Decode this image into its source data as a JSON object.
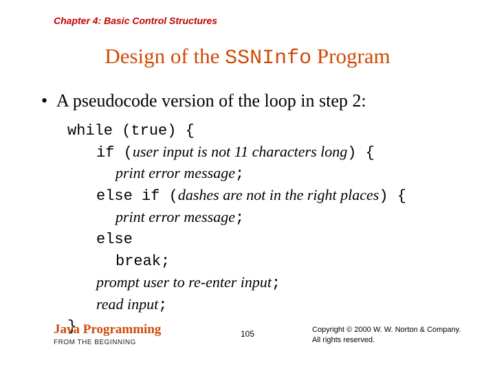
{
  "chapter": "Chapter 4: Basic Control Structures",
  "title": {
    "pre": "Design of the ",
    "code": "SSNInfo",
    "post": " Program"
  },
  "bullet": "A pseudocode version of the loop in step 2:",
  "code": {
    "l1": "while (true) {",
    "l2a": "if (",
    "l2b": "user input is not 11 characters long",
    "l2c": ") {",
    "l3": "print error message",
    "l3s": ";",
    "l4a": "else if (",
    "l4b": "dashes are not in the right places",
    "l4c": ") {",
    "l5": "print error message",
    "l5s": ";",
    "l6": "else",
    "l7": "break;",
    "l8": "prompt user to re-enter input",
    "l8s": ";",
    "l9": "read input",
    "l9s": ";",
    "l10": "}"
  },
  "footer": {
    "brand": "Java Programming",
    "sub": "FROM THE BEGINNING",
    "page": "105",
    "copy1": "Copyright © 2000 W. W. Norton & Company.",
    "copy2": "All rights reserved."
  }
}
